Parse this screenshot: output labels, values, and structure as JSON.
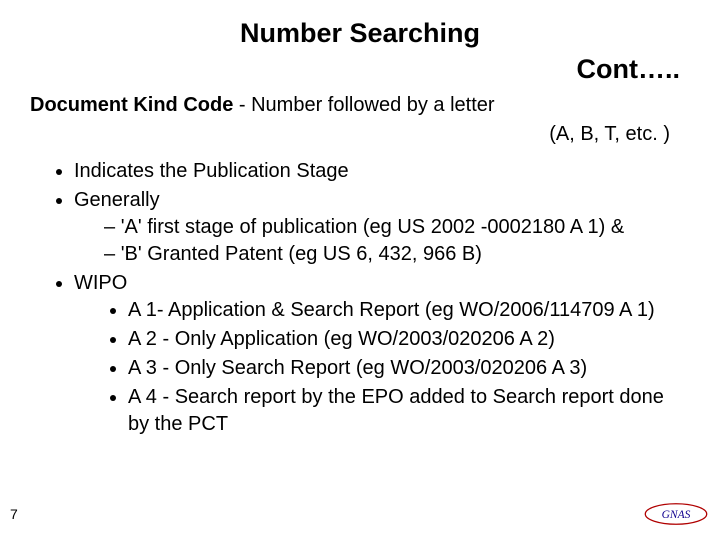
{
  "title": {
    "line1": "Number Searching",
    "line2": "Cont….."
  },
  "kind_intro_bold": "Document Kind Code",
  "kind_intro_rest": " - Number followed by a letter",
  "kind_explain": "(A, B, T, etc. )",
  "bullets": {
    "b1": "Indicates the Publication Stage",
    "b2": "Generally",
    "b2a": "'A' first stage of publication (eg US 2002 -0002180 A 1) &",
    "b2b": "'B'  Granted Patent (eg US 6, 432, 966 B)",
    "b3": "WIPO",
    "b3a": "A 1- Application & Search Report (eg WO/2006/114709 A 1)",
    "b3b": "A 2 - Only Application (eg WO/2003/020206 A 2)",
    "b3c": "A 3 - Only Search Report (eg WO/2003/020206 A 3)",
    "b3d": "A 4 - Search report by the EPO added to Search report done by the PCT"
  },
  "page_number": "7",
  "logo_text": "GNAS"
}
